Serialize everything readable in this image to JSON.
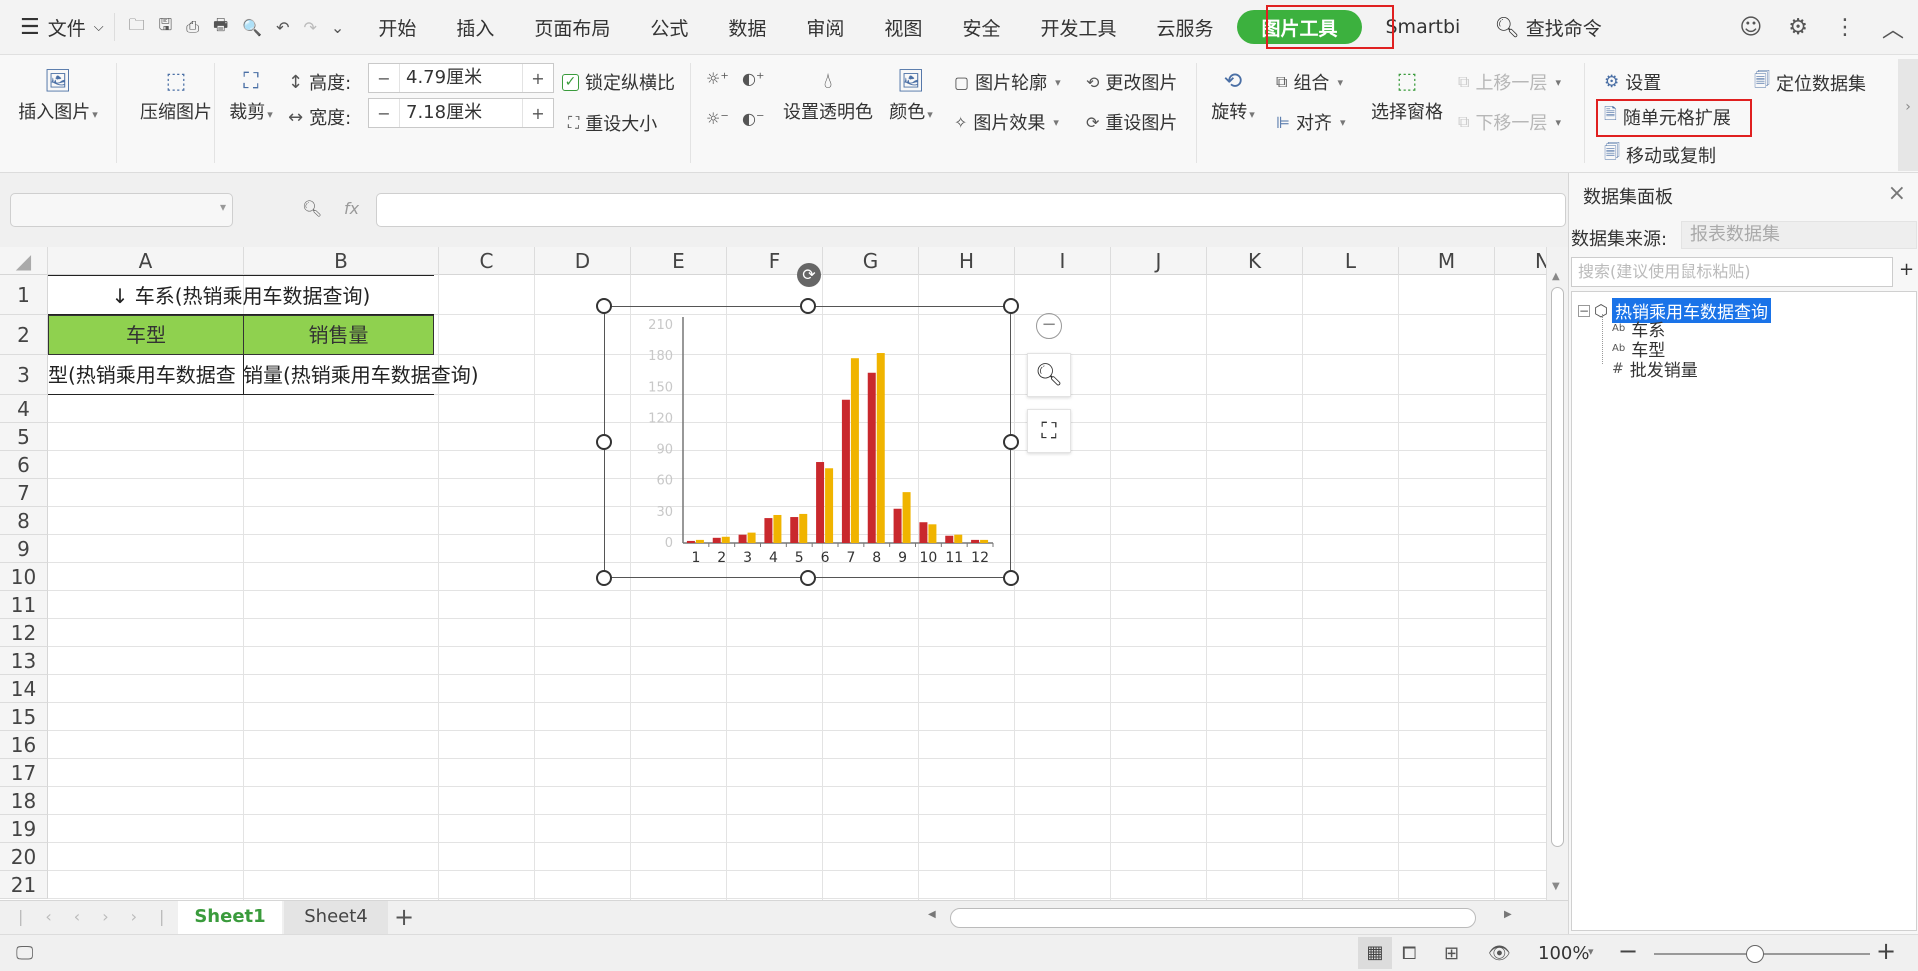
{
  "menubar": {
    "file_label": "文件",
    "tabs": [
      "开始",
      "插入",
      "页面布局",
      "公式",
      "数据",
      "审阅",
      "视图",
      "安全",
      "开发工具",
      "云服务"
    ],
    "active_tab": "图片工具",
    "smartbi_tab": "Smartbi",
    "search_label": "查找命令"
  },
  "ribbon": {
    "insert_picture": "插入图片",
    "compress_picture": "压缩图片",
    "crop": "裁剪",
    "height_label": "高度:",
    "height_value": "4.79厘米",
    "width_label": "宽度:",
    "width_value": "7.18厘米",
    "lock_ratio": "锁定纵横比",
    "reset_size": "重设大小",
    "set_transparent": "设置透明色",
    "color": "颜色",
    "picture_outline": "图片轮廓",
    "picture_effect": "图片效果",
    "change_picture": "更改图片",
    "reset_picture": "重设图片",
    "rotate": "旋转",
    "group": "组合",
    "align": "对齐",
    "selection_pane": "选择窗格",
    "bring_forward": "上移一层",
    "send_backward": "下移一层",
    "settings": "设置",
    "locate_dataset": "定位数据集",
    "expand_with_cell": "随单元格扩展",
    "move_or_copy": "移动或复制"
  },
  "formula_bar": {
    "fx_label": "fx"
  },
  "grid": {
    "columns": [
      "A",
      "B",
      "C",
      "D",
      "E",
      "F",
      "G",
      "H",
      "I",
      "J",
      "K",
      "L",
      "M",
      "N"
    ],
    "rows": [
      "1",
      "2",
      "3",
      "4",
      "5",
      "6",
      "7",
      "8",
      "9",
      "10",
      "11",
      "12",
      "13",
      "14",
      "15",
      "16",
      "17",
      "18",
      "19",
      "20",
      "21"
    ],
    "a1": "↓ 车系(热销乘用车数据查询)",
    "a2": "车型",
    "b2": "销售量",
    "a3": "型(热销乘用车数据查",
    "b3": "销量(热销乘用车数据查询)"
  },
  "chart_data": {
    "type": "bar",
    "categories": [
      "1",
      "2",
      "3",
      "4",
      "5",
      "6",
      "7",
      "8",
      "9",
      "10",
      "11",
      "12"
    ],
    "series": [
      {
        "values": [
          2,
          5,
          8,
          24,
          25,
          78,
          138,
          164,
          33,
          20,
          7,
          3
        ]
      },
      {
        "values": [
          3,
          6,
          10,
          27,
          28,
          72,
          178,
          183,
          49,
          18,
          8,
          3
        ]
      }
    ],
    "yticks": [
      "0",
      "30",
      "60",
      "90",
      "120",
      "150",
      "180",
      "210"
    ],
    "ylim": [
      0,
      210
    ],
    "colors": {
      "series1": "#c9282d",
      "series2": "#f0b400"
    }
  },
  "sheets": {
    "tabs": [
      "Sheet1",
      "Sheet4"
    ],
    "active": "Sheet1",
    "add_symbol": "+"
  },
  "status": {
    "zoom": "100%"
  },
  "panel": {
    "title": "数据集面板",
    "source_label": "数据集来源:",
    "source_value": "报表数据集",
    "search_placeholder": "搜索(建议使用鼠标粘贴)",
    "tree_root": "热销乘用车数据查询",
    "tree_items": [
      {
        "prefix": "Ab",
        "label": "车系"
      },
      {
        "prefix": "Ab",
        "label": "车型"
      },
      {
        "prefix": "#",
        "label": "批发销量"
      }
    ]
  },
  "colors": {
    "accent": "#3cb13e",
    "header_green": "#8fd14f",
    "highlight_red": "#e02020",
    "tree_selection": "#1a73e8"
  }
}
